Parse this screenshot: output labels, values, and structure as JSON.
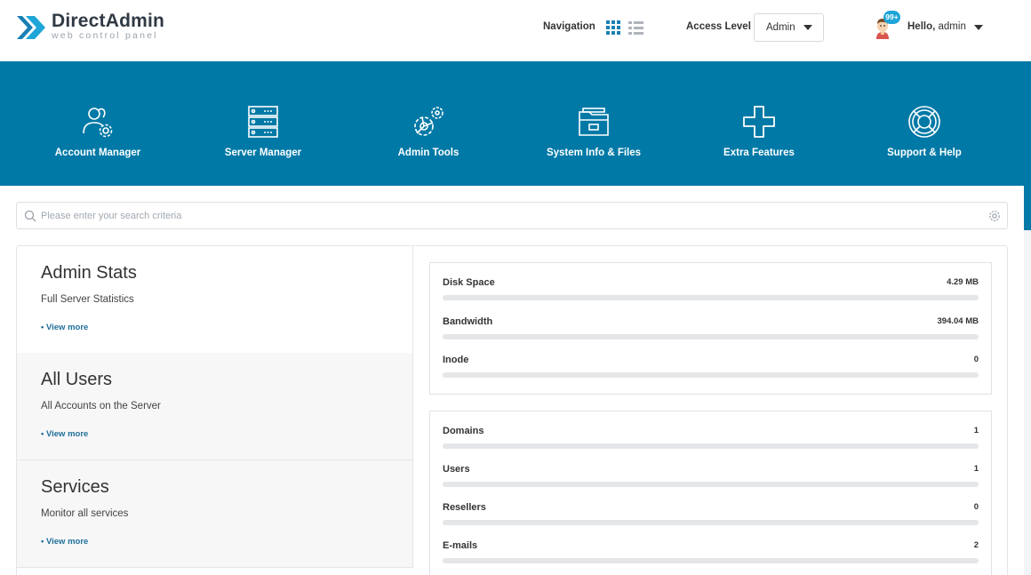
{
  "header": {
    "brand_name": "DirectAdmin",
    "brand_tagline": "web control panel",
    "navigation_label": "Navigation",
    "access_level_label": "Access Level",
    "access_level_value": "Admin",
    "notification_badge": "99+",
    "greeting": "Hello,",
    "username": "admin"
  },
  "menu": [
    {
      "label": "Account Manager",
      "icon": "users-gear-icon"
    },
    {
      "label": "Server Manager",
      "icon": "server-icon"
    },
    {
      "label": "Admin Tools",
      "icon": "gears-icon"
    },
    {
      "label": "System Info & Files",
      "icon": "folder-icon"
    },
    {
      "label": "Extra Features",
      "icon": "plus-icon"
    },
    {
      "label": "Support & Help",
      "icon": "lifebuoy-icon"
    }
  ],
  "search": {
    "placeholder": "Please enter your search criteria"
  },
  "cards": [
    {
      "title": "Admin Stats",
      "desc": "Full Server Statistics",
      "link": "• View more"
    },
    {
      "title": "All Users",
      "desc": "All Accounts on the Server",
      "link": "• View more"
    },
    {
      "title": "Services",
      "desc": "Monitor all services",
      "link": "• View more"
    }
  ],
  "usage_stats": [
    {
      "name": "Disk Space",
      "value": "4.29 MB",
      "fill": 0
    },
    {
      "name": "Bandwidth",
      "value": "394.04 MB",
      "fill": 0
    },
    {
      "name": "Inode",
      "value": "0",
      "fill": 0
    }
  ],
  "count_stats": [
    {
      "name": "Domains",
      "value": "1",
      "fill": 0
    },
    {
      "name": "Users",
      "value": "1",
      "fill": 0
    },
    {
      "name": "Resellers",
      "value": "0",
      "fill": 0
    },
    {
      "name": "E-mails",
      "value": "2",
      "fill": 0
    }
  ],
  "colors": {
    "brand_blue": "#0079a6",
    "accent": "#1a7fb5",
    "badge": "#1fa5d8"
  }
}
